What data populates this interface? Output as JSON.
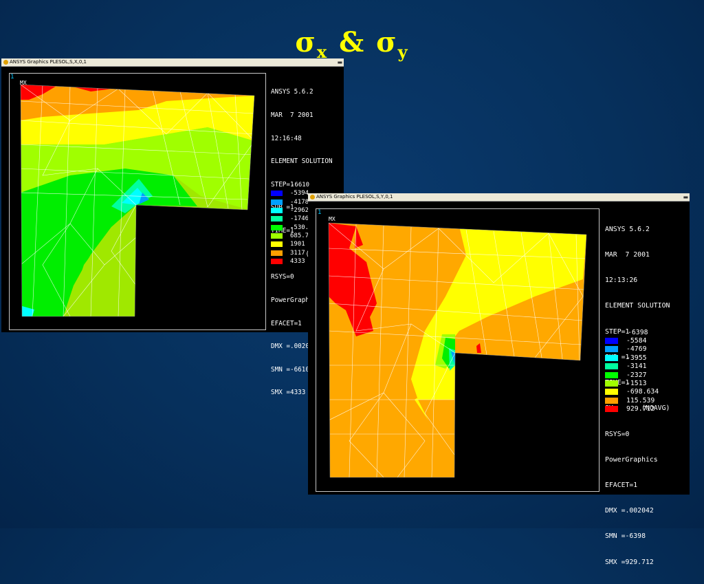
{
  "title": {
    "sigma": "σ",
    "sub_x": "x",
    "amp": "&",
    "sub_y": "y"
  },
  "windows": [
    {
      "titlebar": "ANSYS Graphics   PLESOL,S,X,0,1",
      "window_number": "1",
      "max_label": "MX",
      "min_label": "MN",
      "info_lines": [
        "ANSYS 5.6.2",
        "MAR  7 2001",
        "12:16:48",
        "ELEMENT SOLUTION",
        "STEP=1",
        "SUB =1",
        "TIME=1",
        "SX       (NOAVG)",
        "RSYS=0",
        "PowerGraphics",
        "EFACET=1",
        "DMX =.002042",
        "SMN =-6610",
        "SMX =4333"
      ],
      "legend_min_label": "-6610",
      "legend": [
        {
          "label": "-5394",
          "color": "#0000ff"
        },
        {
          "label": "-4178",
          "color": "#00a0ff"
        },
        {
          "label": "-2962",
          "color": "#00ffff"
        },
        {
          "label": "-1746",
          "color": "#00ffa0"
        },
        {
          "label": "-530.5",
          "color": "#00ff00"
        },
        {
          "label": "685.7",
          "color": "#a0ff00"
        },
        {
          "label": "1901",
          "color": "#ffff00"
        },
        {
          "label": "3117",
          "color": "#ffa000"
        },
        {
          "label": "4333",
          "color": "#ff0000"
        }
      ]
    },
    {
      "titlebar": "ANSYS Graphics   PLESOL,S,Y,0,1",
      "window_number": "1",
      "max_label": "MX",
      "min_label": "MN",
      "info_lines": [
        "ANSYS 5.6.2",
        "MAR  7 2001",
        "12:13:26",
        "ELEMENT SOLUTION",
        "STEP=1",
        "SUB =1",
        "TIME=1",
        "SY       (NOAVG)",
        "RSYS=0",
        "PowerGraphics",
        "EFACET=1",
        "DMX =.002042",
        "SMN =-6398",
        "SMX =929.712"
      ],
      "legend_min_label": "-6398",
      "legend": [
        {
          "label": "-5584",
          "color": "#0000ff"
        },
        {
          "label": "-4769",
          "color": "#00a0ff"
        },
        {
          "label": "-3955",
          "color": "#00ffff"
        },
        {
          "label": "-3141",
          "color": "#00ffa0"
        },
        {
          "label": "-2327",
          "color": "#00ff00"
        },
        {
          "label": "-1513",
          "color": "#a0ff00"
        },
        {
          "label": "-698.634",
          "color": "#ffff00"
        },
        {
          "label": "115.539",
          "color": "#ffa000"
        },
        {
          "label": "929.712",
          "color": "#ff0000"
        }
      ]
    }
  ]
}
